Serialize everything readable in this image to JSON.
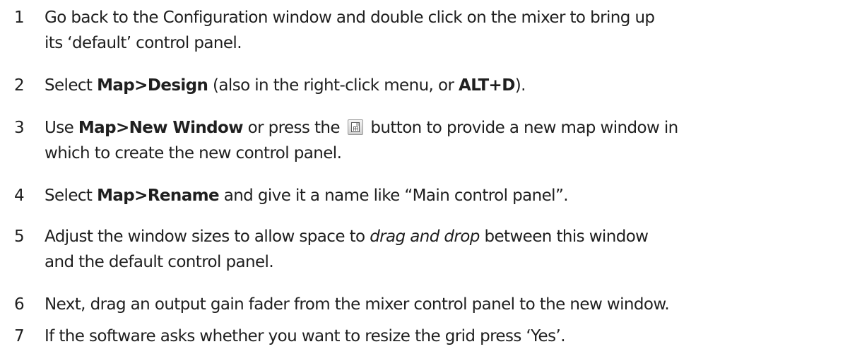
{
  "steps": [
    {
      "number": "1",
      "line1": "Go back to the Configuration window and double click on the mixer to bring up",
      "line2": "its ‘default’ control panel."
    },
    {
      "number": "2",
      "pre": "Select ",
      "bold1": "Map>Design",
      "mid": " (also in the right-click menu, or ",
      "bold2": "ALT+D",
      "post": ")."
    },
    {
      "number": "3",
      "pre": "Use ",
      "bold1": "Map>New Window",
      "mid": " or press the ",
      "icon": "new-map-window-icon",
      "post": " button to provide a new map window in",
      "line2": "which to create the new control panel."
    },
    {
      "number": "4",
      "pre": "Select ",
      "bold1": "Map>Rename",
      "post": " and give it a name like “Main control panel”."
    },
    {
      "number": "5",
      "pre": "Adjust the window sizes to allow space to ",
      "italic": "drag and drop",
      "post": " between this window",
      "line2": "and the default control panel."
    },
    {
      "number": "6",
      "text": "Next, drag an output gain fader from the mixer control panel to the new window."
    },
    {
      "number": "7",
      "text": "If the software asks whether you want to resize the grid press ‘Yes’."
    }
  ]
}
